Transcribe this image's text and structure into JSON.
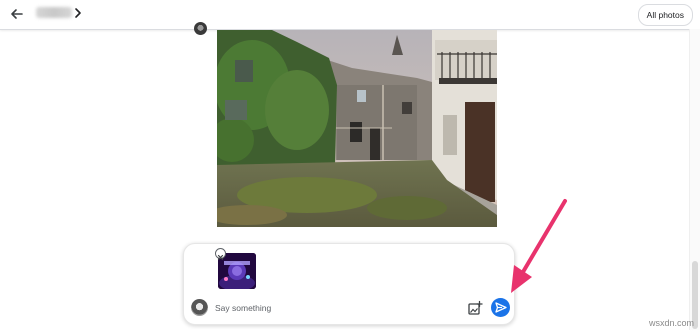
{
  "topbar": {
    "back_icon": "arrow-left-icon",
    "chevron_icon": "chevron-right-icon",
    "all_photos_label": "All photos"
  },
  "composer": {
    "placeholder": "Say something",
    "remove_icon": "close-icon",
    "add_photo_icon": "add-photo-icon",
    "send_icon": "send-icon"
  },
  "colors": {
    "send_button": "#1a73e8",
    "annotation_arrow": "#e8336d"
  },
  "watermark": "wsxdn.com"
}
